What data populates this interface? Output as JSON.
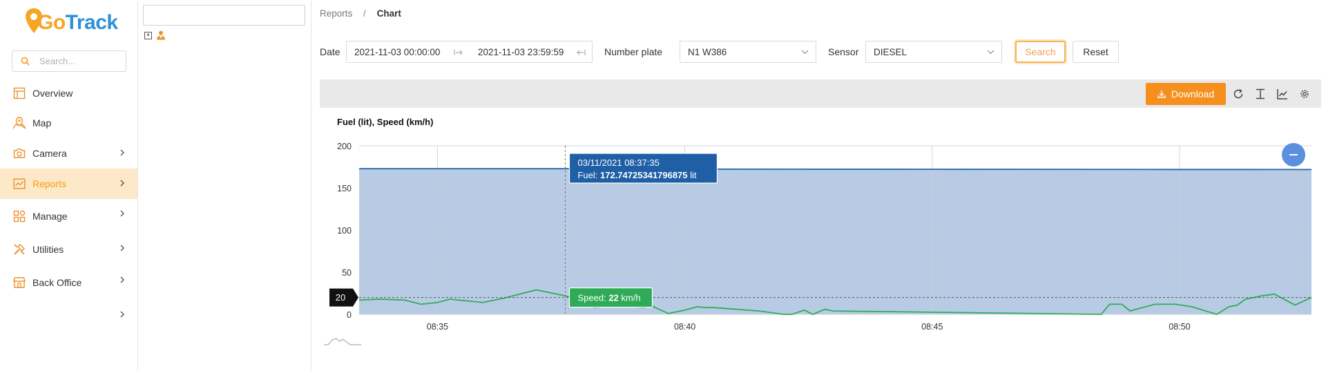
{
  "app": {
    "logo_go": "Go",
    "logo_track": "Track"
  },
  "sidebar": {
    "search_placeholder": "Search...",
    "items": [
      {
        "label": "Overview",
        "icon": "overview-icon"
      },
      {
        "label": "Map",
        "icon": "map-icon"
      },
      {
        "label": "Camera",
        "icon": "camera-icon",
        "chevron": true
      },
      {
        "label": "Reports",
        "icon": "reports-icon",
        "chevron": true,
        "active": true
      },
      {
        "label": "Manage",
        "icon": "manage-icon",
        "chevron": true
      },
      {
        "label": "Utilities",
        "icon": "utilities-icon",
        "chevron": true
      },
      {
        "label": "Back Office",
        "icon": "back-office-icon",
        "chevron": true
      },
      {
        "label": "",
        "icon": "",
        "chevron": true
      }
    ]
  },
  "tree": {
    "search_value": ""
  },
  "breadcrumb": {
    "root": "Reports",
    "separator": "/",
    "current": "Chart"
  },
  "filters": {
    "date_label": "Date",
    "date_start": "2021-11-03 00:00:00",
    "date_end": "2021-11-03 23:59:59",
    "plate_label": "Number plate",
    "plate_value": "N1 W386",
    "sensor_label": "Sensor",
    "sensor_value": "DIESEL",
    "search_button": "Search",
    "reset_button": "Reset"
  },
  "toolbar": {
    "download_label": "Download"
  },
  "colors": {
    "accent": "#f5901e",
    "fuel_fill": "#b7cce4",
    "fuel_line": "#2a63a8",
    "speed_line": "#2fab57",
    "active_nav_bg": "#fde8c8"
  },
  "chart_data": {
    "type": "area",
    "title": "Fuel (lit), Speed (km/h)",
    "ylim": [
      0,
      200
    ],
    "y_ticks": [
      0,
      50,
      100,
      150,
      200
    ],
    "x_ticks": [
      "08:35",
      "08:40",
      "08:45",
      "08:50"
    ],
    "x_range": [
      "08:33:25",
      "08:52:40"
    ],
    "grid": true,
    "series": [
      {
        "name": "Fuel",
        "unit": "lit",
        "x": [
          "08:33:25",
          "08:37:35",
          "08:40:00",
          "08:45:00",
          "08:50:00",
          "08:52:40"
        ],
        "y": [
          172.8,
          172.74725341796875,
          172.3,
          172.1,
          171.9,
          171.8
        ]
      },
      {
        "name": "Speed",
        "unit": "km/h",
        "x": [
          "08:33:25",
          "08:33:50",
          "08:34:20",
          "08:34:40",
          "08:35:00",
          "08:35:15",
          "08:35:55",
          "08:36:20",
          "08:37:00",
          "08:37:35",
          "08:37:50",
          "08:38:10",
          "08:38:30",
          "08:38:50",
          "08:39:10",
          "08:39:20",
          "08:39:40",
          "08:40:00",
          "08:40:15",
          "08:40:25",
          "08:40:35",
          "08:41:30",
          "08:42:00",
          "08:42:10",
          "08:42:25",
          "08:42:35",
          "08:42:50",
          "08:43:00",
          "08:48:25",
          "08:48:35",
          "08:48:50",
          "08:49:00",
          "08:49:30",
          "08:49:55",
          "08:50:15",
          "08:50:45",
          "08:51:00",
          "08:51:10",
          "08:51:20",
          "08:51:40",
          "08:51:55",
          "08:52:20",
          "08:52:40"
        ],
        "y": [
          17,
          18,
          17,
          12,
          14,
          18,
          14,
          19,
          29,
          22,
          18,
          8,
          10,
          10,
          8,
          10,
          1,
          5,
          9,
          8,
          8,
          4,
          0,
          0,
          5,
          0,
          6,
          4,
          0,
          12,
          12,
          4,
          12,
          12,
          9,
          0,
          9,
          11,
          18,
          22,
          24,
          11,
          20
        ]
      }
    ],
    "tooltip_fuel": {
      "datetime": "03/11/2021 08:37:35",
      "label": "Fuel:",
      "value": "172.74725341796875",
      "unit": "lit"
    },
    "tooltip_speed": {
      "label": "Speed:",
      "value": "22",
      "unit": "km/h"
    },
    "crosshair_y_label": "20"
  }
}
